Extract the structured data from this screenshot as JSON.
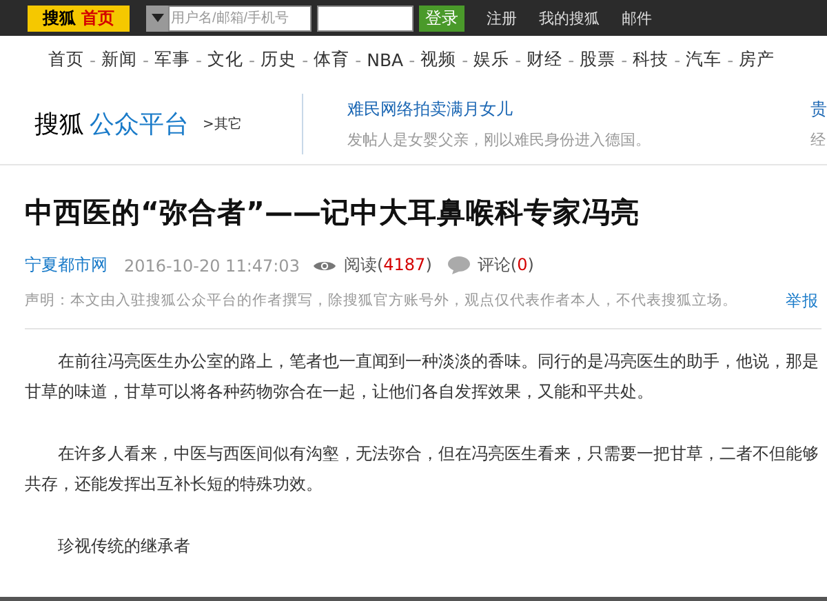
{
  "top_bar": {
    "logo": {
      "brand": "搜狐",
      "home": "首页"
    },
    "username": {
      "placeholder": "用户名/邮箱/手机号"
    },
    "login": "登录",
    "links": [
      "注册",
      "我的搜狐",
      "邮件"
    ]
  },
  "nav_separator": "-",
  "nav": [
    "首页",
    "新闻",
    "军事",
    "文化",
    "历史",
    "体育",
    "NBA",
    "视频",
    "娱乐",
    "财经",
    "股票",
    "科技",
    "汽车",
    "房产"
  ],
  "header": {
    "brand": "搜狐",
    "platform": "公众平台",
    "other": ">其它",
    "news": [
      {
        "title": "难民网络拍卖满月女儿",
        "summary": "发帖人是女婴父亲，刚以难民身份进入德国。"
      },
      {
        "title": "贵",
        "summary": "经"
      }
    ]
  },
  "article": {
    "title": "中西医的“弥合者”——记中大耳鼻喉科专家冯亮",
    "source": "宁夏都市网",
    "date": "2016-10-20 11:47:03",
    "reads": {
      "prefix": "阅读(",
      "count": "4187",
      "suffix": ")"
    },
    "comments": {
      "prefix": "评论(",
      "count": "0",
      "suffix": ")"
    },
    "disclaimer": "声明：本文由入驻搜狐公众平台的作者撰写，除搜狐官方账号外，观点仅代表作者本人，不代表搜狐立场。",
    "report": "举报",
    "paragraphs": [
      {
        "kind": "text",
        "text": "在前往冯亮医生办公室的路上，笔者也一直闻到一种淡淡的香味。同行的是冯亮医生的助手，他说，那是甘草的味道，甘草可以将各种药物弥合在一起，让他们各自发挥效果，又能和平共处。"
      },
      {
        "kind": "text",
        "text": "在许多人看来，中医与西医间似有沟壑，无法弥合，但在冯亮医生看来，只需要一把甘草，二者不但能够共存，还能发挥出互补长短的特殊功效。"
      },
      {
        "kind": "text",
        "text": "珍视传统的继承者"
      }
    ]
  }
}
